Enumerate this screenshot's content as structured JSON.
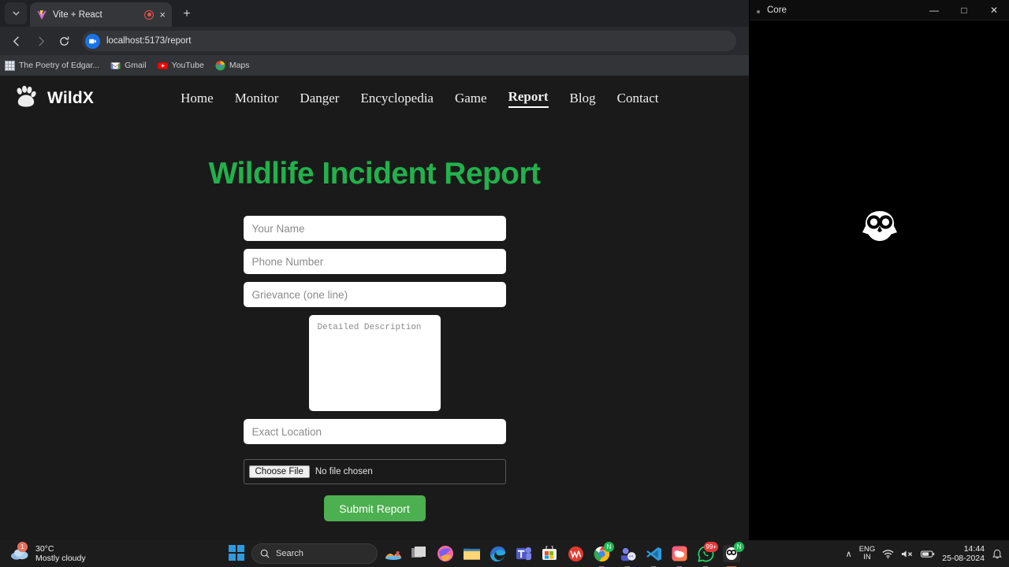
{
  "browser": {
    "tab": {
      "title": "Vite + React",
      "favicon": "vite-icon",
      "recording_indicator": "record-icon",
      "close": "×"
    },
    "new_tab": "+",
    "tab_list_chevron": "⌄",
    "nav": {
      "back": "←",
      "forward": "→",
      "reload": "⟳"
    },
    "omnibox": {
      "url": "localhost:5173/report",
      "site_icon": "screen-share-icon"
    },
    "bookmarks": [
      {
        "label": "The Poetry of Edgar...",
        "icon": "grid-icon"
      },
      {
        "label": "Gmail",
        "icon": "gmail-icon"
      },
      {
        "label": "YouTube",
        "icon": "youtube-icon"
      },
      {
        "label": "Maps",
        "icon": "maps-icon"
      }
    ]
  },
  "site": {
    "brand": {
      "name": "WildX",
      "logo": "paw-icon"
    },
    "nav_links": [
      {
        "label": "Home",
        "active": false
      },
      {
        "label": "Monitor",
        "active": false
      },
      {
        "label": "Danger",
        "active": false
      },
      {
        "label": "Encyclopedia",
        "active": false
      },
      {
        "label": "Game",
        "active": false
      },
      {
        "label": "Report",
        "active": true
      },
      {
        "label": "Blog",
        "active": false
      },
      {
        "label": "Contact",
        "active": false
      }
    ],
    "title": "Wildlife Incident Report",
    "title_color": "#22b14c",
    "form": {
      "name_placeholder": "Your Name",
      "name_value": "",
      "phone_placeholder": "Phone Number",
      "phone_value": "",
      "grievance_placeholder": "Grievance (one line)",
      "grievance_value": "",
      "description_placeholder": "Detailed Description",
      "description_value": "",
      "location_placeholder": "Exact Location",
      "location_value": "",
      "file_button": "Choose File",
      "file_status": "No file chosen",
      "submit_label": "Submit Report",
      "submit_color": "#4caf50"
    }
  },
  "core_window": {
    "title": "Core",
    "minimize": "—",
    "maximize": "□",
    "close": "✕",
    "content_icon": "owl-icon"
  },
  "taskbar": {
    "weather": {
      "temperature": "30°C",
      "condition": "Mostly cloudy",
      "badge": "1",
      "icon": "cloud-icon"
    },
    "start": "windows-icon",
    "search": {
      "placeholder": "Search",
      "icon": "search-icon"
    },
    "apps": [
      {
        "name": "weather-tile-icon",
        "badge": "",
        "state": "none"
      },
      {
        "name": "task-view-icon",
        "badge": "",
        "state": "none"
      },
      {
        "name": "copilot-icon",
        "badge": "",
        "state": "none"
      },
      {
        "name": "file-explorer-icon",
        "badge": "",
        "state": "none"
      },
      {
        "name": "edge-icon",
        "badge": "",
        "state": "none"
      },
      {
        "name": "teams-icon",
        "badge": "",
        "state": "none"
      },
      {
        "name": "microsoft-store-icon",
        "badge": "",
        "state": "none"
      },
      {
        "name": "wps-office-icon",
        "badge": "",
        "state": "none"
      },
      {
        "name": "chrome-icon",
        "badge": "N",
        "state": "running"
      },
      {
        "name": "teams-chat-icon",
        "badge": "",
        "state": "running"
      },
      {
        "name": "vscode-icon",
        "badge": "",
        "state": "running"
      },
      {
        "name": "creative-cloud-icon",
        "badge": "",
        "state": "running"
      },
      {
        "name": "whatsapp-icon",
        "badge": "99+",
        "state": "running"
      },
      {
        "name": "owl-app-icon",
        "badge": "N",
        "state": "active"
      }
    ],
    "tray": {
      "overflow": "∧",
      "language_line1": "ENG",
      "language_line2": "IN",
      "wifi": "wifi-icon",
      "volume": "volume-muted-icon",
      "battery": "battery-icon",
      "time": "14:44",
      "date": "25-08-2024",
      "notifications": "notification-bell-icon"
    }
  }
}
